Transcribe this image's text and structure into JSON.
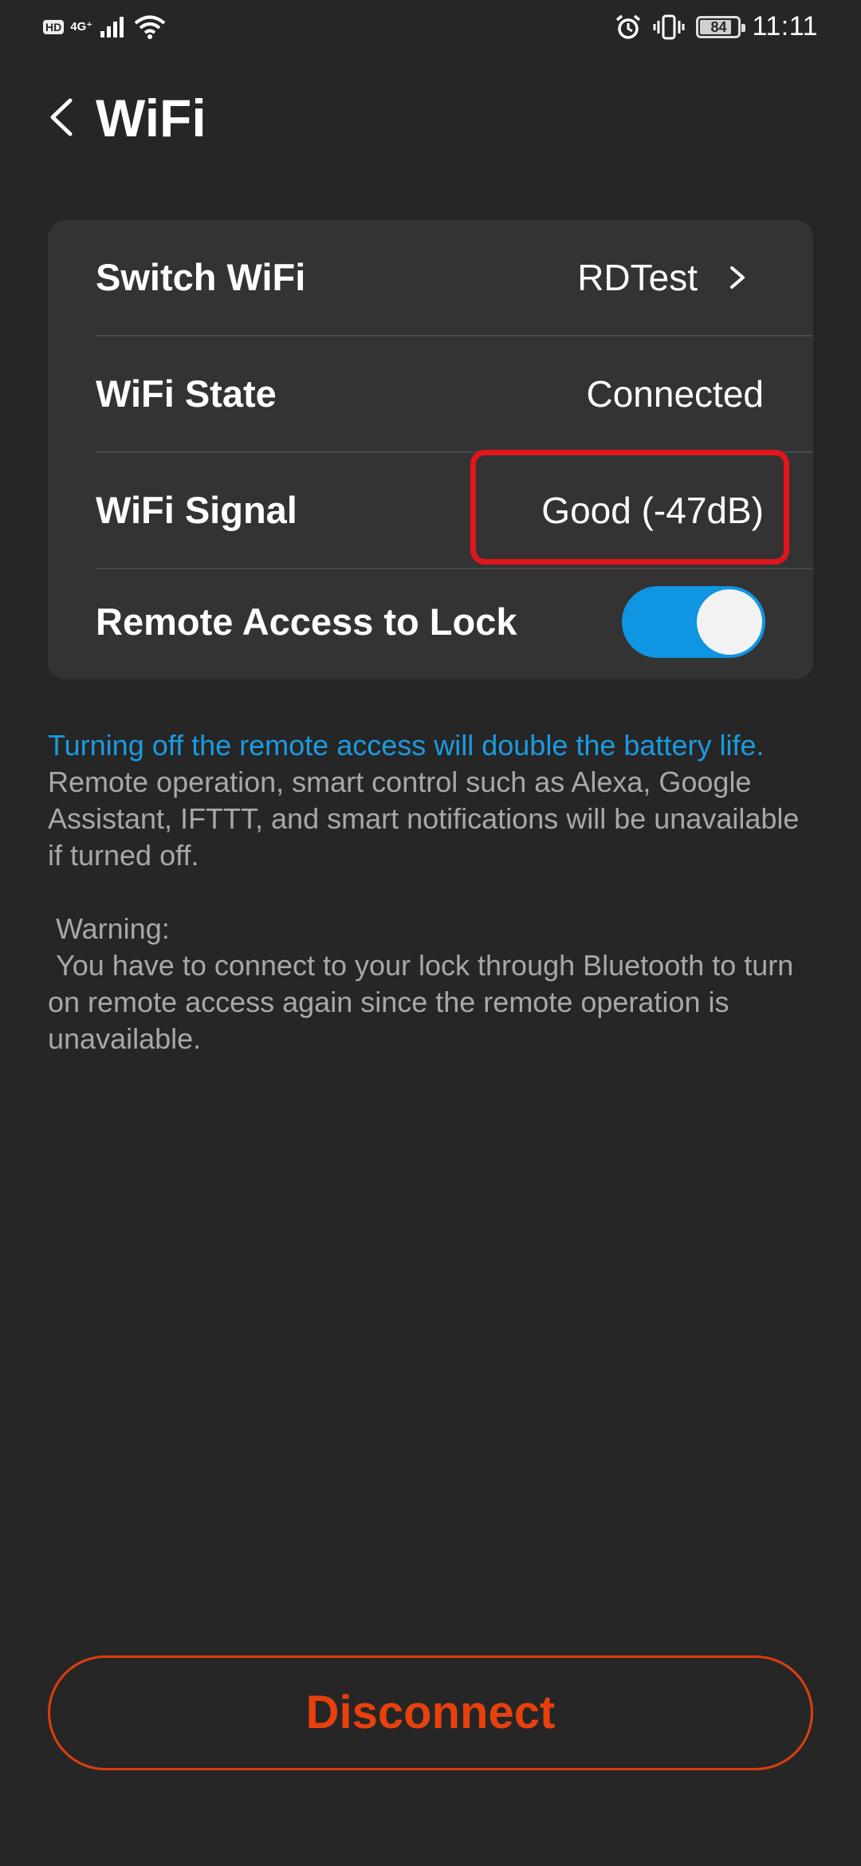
{
  "status_bar": {
    "hd": "HD",
    "network": "4G⁺",
    "battery_level": "84",
    "battery_fraction": 0.84,
    "time": "11:11",
    "icons": [
      "signal-icon",
      "wifi-icon",
      "alarm-icon",
      "vibrate-icon",
      "battery-icon"
    ]
  },
  "header": {
    "title": "WiFi"
  },
  "settings": {
    "switch_wifi": {
      "label": "Switch WiFi",
      "value": "RDTest"
    },
    "wifi_state": {
      "label": "WiFi State",
      "value": "Connected"
    },
    "wifi_signal": {
      "label": "WiFi Signal",
      "value": "Good (-47dB)"
    },
    "remote_access": {
      "label": "Remote Access to Lock",
      "enabled": true
    }
  },
  "info": {
    "highlight": "Turning off the remote access will double the battery life.",
    "description": "Remote operation, smart control such as Alexa, Google Assistant, IFTTT, and smart notifications will be unavailable if turned off.",
    "warning_title": " Warning:",
    "warning_body": " You have to connect to your lock through Bluetooth to turn on remote access again since the remote operation is unavailable."
  },
  "actions": {
    "disconnect": "Disconnect"
  },
  "colors": {
    "background": "#262626",
    "card": "#333333",
    "accent_blue": "#1a9be0",
    "toggle_on": "#0f95e2",
    "disconnect": "#e8400d",
    "highlight_border": "#e0161c"
  }
}
